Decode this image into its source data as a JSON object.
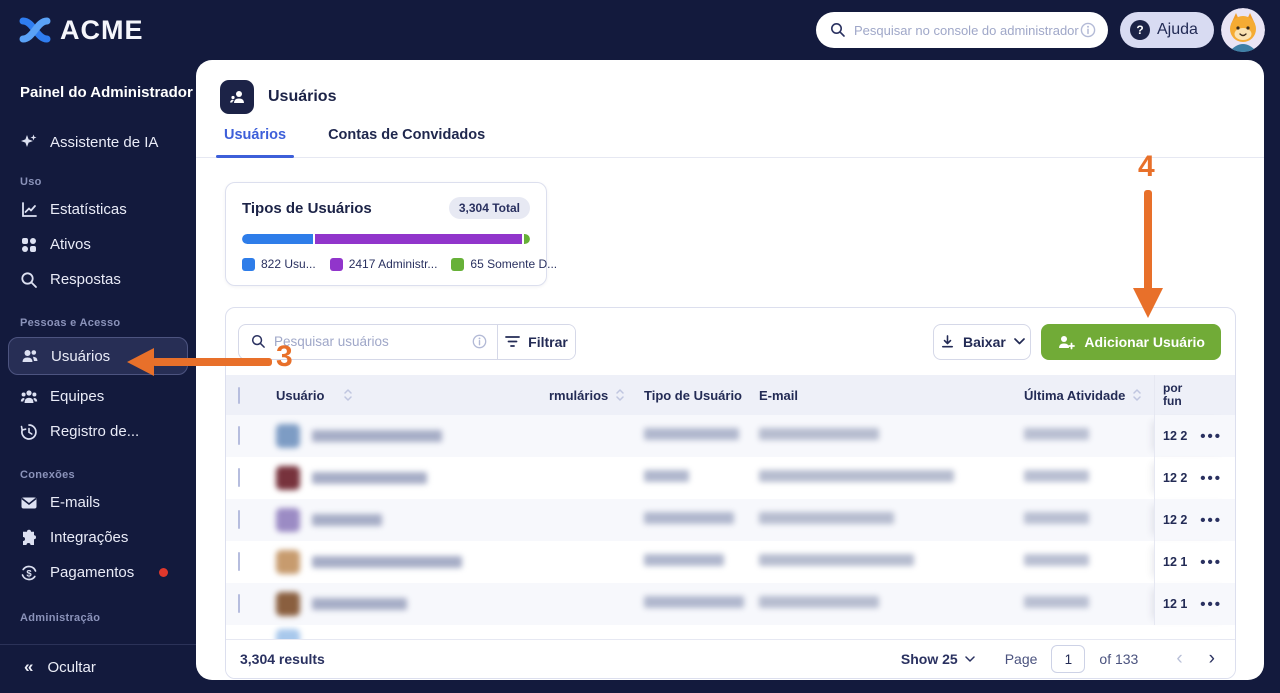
{
  "topbar": {
    "brand": "ACME",
    "search_placeholder": "Pesquisar no console do administrador",
    "help_label": "Ajuda"
  },
  "sidebar": {
    "title": "Painel do Administrador",
    "assistant_label": "Assistente de IA",
    "section_uso": "Uso",
    "stats_label": "Estatísticas",
    "assets_label": "Ativos",
    "answers_label": "Respostas",
    "section_people": "Pessoas e Acesso",
    "users_label": "Usuários",
    "teams_label": "Equipes",
    "log_label": "Registro de...",
    "section_connections": "Conexões",
    "emails_label": "E-mails",
    "integrations_label": "Integrações",
    "payments_label": "Pagamentos",
    "section_admin": "Administração",
    "collapse_label": "Ocultar",
    "collapse_icon": "«"
  },
  "page": {
    "title": "Usuários",
    "tab_users": "Usuários",
    "tab_guests": "Contas de Convidados"
  },
  "types_card": {
    "title": "Tipos de Usuários",
    "total_badge": "3,304 Total",
    "total": 3304,
    "segments": [
      {
        "label": "822 Usu...",
        "value": 822,
        "color": "#2e7de9",
        "pct": "24.9%"
      },
      {
        "label": "2417 Administr...",
        "value": 2417,
        "color": "#9135cb",
        "pct": "73.1%"
      },
      {
        "label": "65 Somente D...",
        "value": 65,
        "color": "#67b138",
        "pct": "2.0%"
      }
    ]
  },
  "toolbar": {
    "search_placeholder": "Pesquisar usuários",
    "filter_label": "Filtrar",
    "download_label": "Baixar",
    "add_user_label": "Adicionar Usuário"
  },
  "table": {
    "col_user": "Usuário",
    "col_forms": "rmulários",
    "col_type": "Tipo de Usuário",
    "col_email": "E-mail",
    "col_last": "Última Atividade",
    "col_tail": "por fun",
    "ellipsis": "•••",
    "rows": [
      {
        "tail": "12 2",
        "avatar_color": "#7d9cc4"
      },
      {
        "tail": "12 2",
        "avatar_color": "#77323c"
      },
      {
        "tail": "12 2",
        "avatar_color": "#9b8bc4"
      },
      {
        "tail": "12 1",
        "avatar_color": "#c79b6e"
      },
      {
        "tail": "12 1",
        "avatar_color": "#8a5f3f"
      }
    ],
    "partial_row_avatar_color": "#a8c8ec"
  },
  "pagination": {
    "results": "3,304 results",
    "show_label": "Show 25",
    "page_label": "Page",
    "page_value": "1",
    "of_label": "of 133",
    "prev": "‹",
    "next": "›"
  },
  "annotations": {
    "step3": "3",
    "step4": "4",
    "arrow_color": "#e8702a"
  }
}
